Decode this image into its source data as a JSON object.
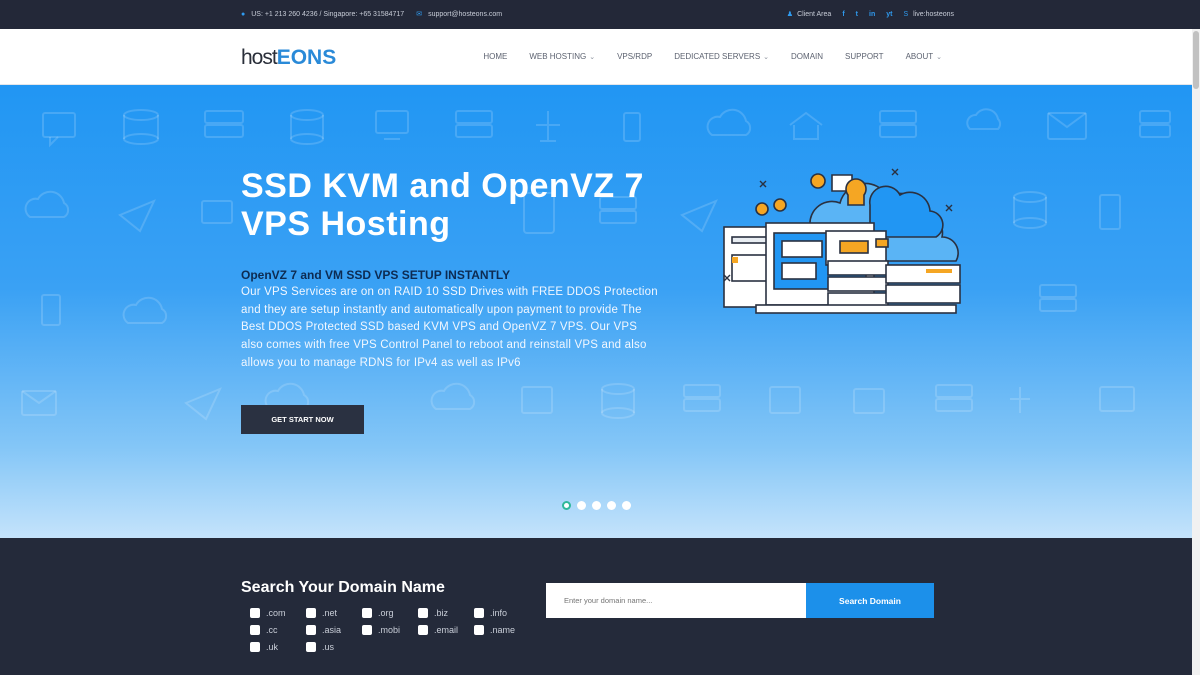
{
  "topbar": {
    "phone": "US: +1 213 260 4236 / Singapore: +65 31584717",
    "email": "support@hosteons.com",
    "client_area": "Client Area",
    "social": [
      "f",
      "t",
      "in",
      "yt"
    ],
    "skype": "live:hosteons"
  },
  "logo": {
    "part1": "host",
    "part2": "EONS"
  },
  "menu": [
    {
      "label": "HOME"
    },
    {
      "label": "WEB HOSTING",
      "dropdown": true
    },
    {
      "label": "VPS/RDP"
    },
    {
      "label": "DEDICATED SERVERS",
      "dropdown": true
    },
    {
      "label": "DOMAIN"
    },
    {
      "label": "SUPPORT"
    },
    {
      "label": "ABOUT",
      "dropdown": true
    }
  ],
  "hero": {
    "title": "SSD KVM and OpenVZ 7 VPS Hosting",
    "subtitle": "OpenVZ 7 and VM SSD VPS SETUP INSTANTLY",
    "text": "Our VPS Services are on on RAID 10 SSD Drives with FREE DDOS Protection and they are setup instantly and automatically upon payment to provide The Best DDOS Protected SSD based KVM VPS and OpenVZ 7 VPS. Our VPS also comes with free VPS Control Panel to reboot and reinstall VPS and also allows you to manage RDNS for IPv4 as well as IPv6",
    "button": "GET START NOW",
    "slides": 5,
    "active_slide": 1
  },
  "domain": {
    "title": "Search Your Domain Name",
    "tlds": [
      ".com",
      ".net",
      ".org",
      ".biz",
      ".info",
      ".cc",
      ".asia",
      ".mobi",
      ".email",
      ".name",
      ".uk",
      ".us"
    ],
    "placeholder": "Enter your domain name...",
    "button": "Search Domain"
  },
  "colors": {
    "accent": "#2196f3",
    "dark": "#232838",
    "button_dark": "#2a3141",
    "search_button": "#1c90ea"
  }
}
